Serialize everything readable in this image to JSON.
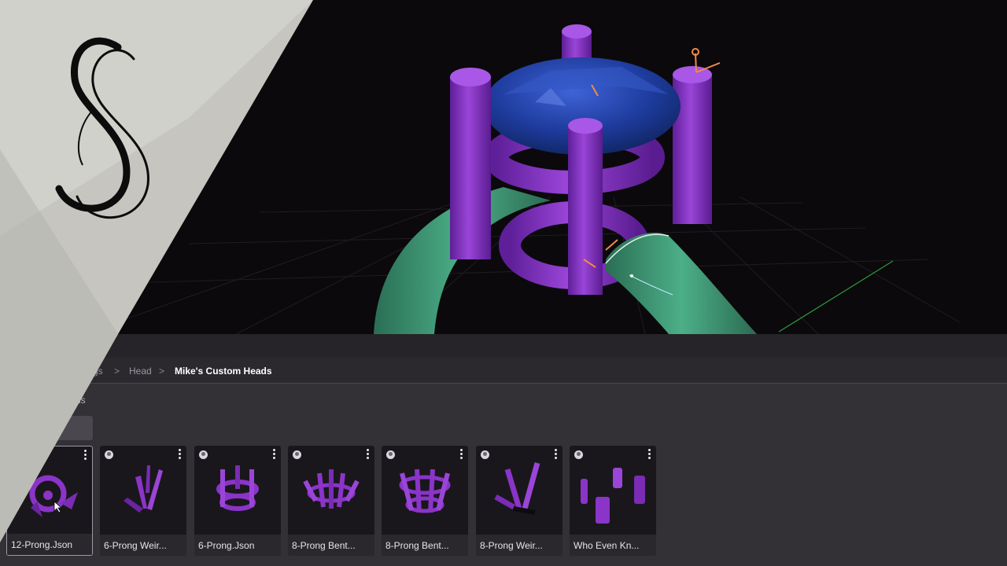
{
  "breadcrumb": {
    "items": [
      "gs",
      "Head",
      "Mike's Custom Heads"
    ],
    "separator": ">"
  },
  "folder_label": "ds",
  "cards": [
    {
      "label": "12-Prong.Json",
      "selected": true
    },
    {
      "label": "6-Prong Weir..."
    },
    {
      "label": "6-Prong.Json"
    },
    {
      "label": "8-Prong Bent..."
    },
    {
      "label": "8-Prong Bent..."
    },
    {
      "label": "8-Prong Weir..."
    },
    {
      "label": "Who Even Kn..."
    }
  ],
  "colors": {
    "prong_purple": "#8a34c8",
    "gem_blue": "#1c3f9e",
    "shank_green": "#3f9c78",
    "panel_bg": "#333036"
  },
  "icons": {
    "logo": "script-s-logo",
    "card_owner": "user-avatar-icon",
    "card_menu": "kebab-menu-icon"
  }
}
